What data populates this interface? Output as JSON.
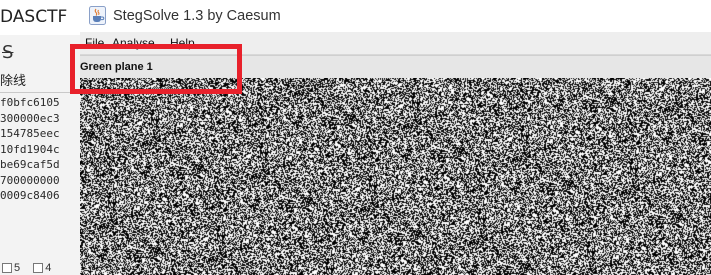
{
  "background_window": {
    "title_fragment": "DASCTF",
    "strike_icon": "strikethrough-icon",
    "strike_label": "除线",
    "hex_lines": [
      "f0bfc6105",
      "300000ec3",
      "154785eec",
      "10fd1904c",
      "be69caf5d",
      "700000000",
      "0009c8406"
    ],
    "bottom_items": [
      "5",
      "4"
    ]
  },
  "stegsolve": {
    "app_icon": "java-coffee-cup-icon",
    "title": "StegSolve 1.3 by Caesum",
    "menu": [
      "File",
      "Analyse",
      "Help"
    ],
    "plane_label": "Green plane 1",
    "image_kind": "random black-and-white noise"
  },
  "annotation": {
    "color": "#e8212b"
  }
}
